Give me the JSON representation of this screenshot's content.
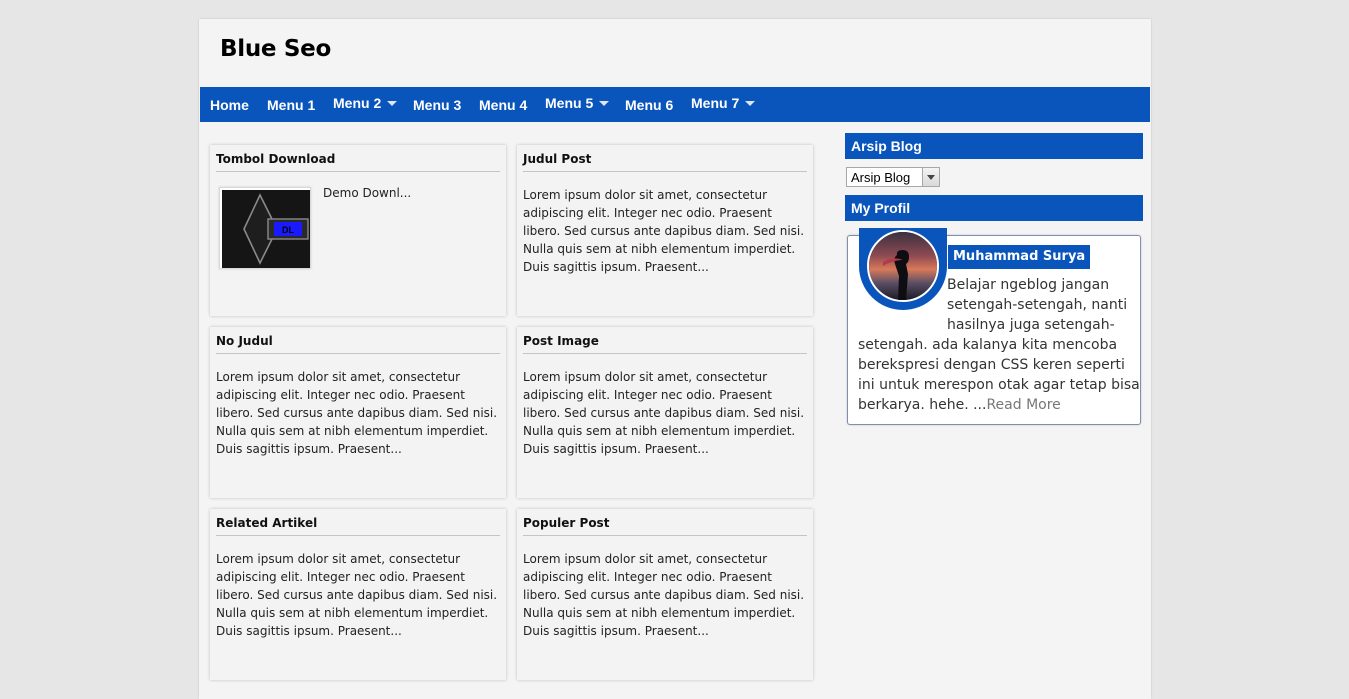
{
  "site": {
    "title": "Blue Seo"
  },
  "nav": {
    "items": [
      {
        "label": "Home",
        "dropdown": false
      },
      {
        "label": "Menu 1",
        "dropdown": false
      },
      {
        "label": "Menu 2",
        "dropdown": true
      },
      {
        "label": "Menu 3",
        "dropdown": false
      },
      {
        "label": "Menu 4",
        "dropdown": false
      },
      {
        "label": "Menu 5",
        "dropdown": true
      },
      {
        "label": "Menu 6",
        "dropdown": false
      },
      {
        "label": "Menu 7",
        "dropdown": true
      }
    ]
  },
  "posts": [
    {
      "title": "Tombol Download",
      "excerpt": "Demo Downl..."
    },
    {
      "title": "Judul Post",
      "excerpt": "Lorem ipsum dolor sit amet, consectetur adipiscing elit. Integer nec odio. Praesent libero. Sed cursus ante dapibus diam. Sed nisi. Nulla quis sem at nibh elementum imperdiet. Duis sagittis ipsum. Praesent..."
    },
    {
      "title": "No Judul",
      "excerpt": "Lorem ipsum dolor sit amet, consectetur adipiscing elit. Integer nec odio. Praesent libero. Sed cursus ante dapibus diam. Sed nisi. Nulla quis sem at nibh elementum imperdiet. Duis sagittis ipsum. Praesent..."
    },
    {
      "title": "Post Image",
      "excerpt": "Lorem ipsum dolor sit amet, consectetur adipiscing elit. Integer nec odio. Praesent libero. Sed cursus ante dapibus diam. Sed nisi. Nulla quis sem at nibh elementum imperdiet. Duis sagittis ipsum. Praesent..."
    },
    {
      "title": "Related Artikel",
      "excerpt": "Lorem ipsum dolor sit amet, consectetur adipiscing elit. Integer nec odio. Praesent libero. Sed cursus ante dapibus diam. Sed nisi. Nulla quis sem at nibh elementum imperdiet. Duis sagittis ipsum. Praesent..."
    },
    {
      "title": "Populer Post",
      "excerpt": "Lorem ipsum dolor sit amet, consectetur adipiscing elit. Integer nec odio. Praesent libero. Sed cursus ante dapibus diam. Sed nisi. Nulla quis sem at nibh elementum imperdiet. Duis sagittis ipsum. Praesent..."
    }
  ],
  "sidebar": {
    "archive": {
      "title": "Arsip Blog",
      "select_value": "Arsip Blog"
    },
    "profile": {
      "title": "My Profil",
      "name": "Muhammad Surya",
      "bio": "Belajar ngeblog jangan setengah-setengah, nanti hasilnya juga setengah-setengah. ada kalanya kita mencoba berekspresi dengan CSS keren seperti ini untuk merespon otak agar tetap bisa berkarya. hehe. ...",
      "read_more": "Read More"
    }
  },
  "colors": {
    "accent": "#0a55bb",
    "background": "#e6e6e6",
    "content": "#f4f4f4"
  }
}
